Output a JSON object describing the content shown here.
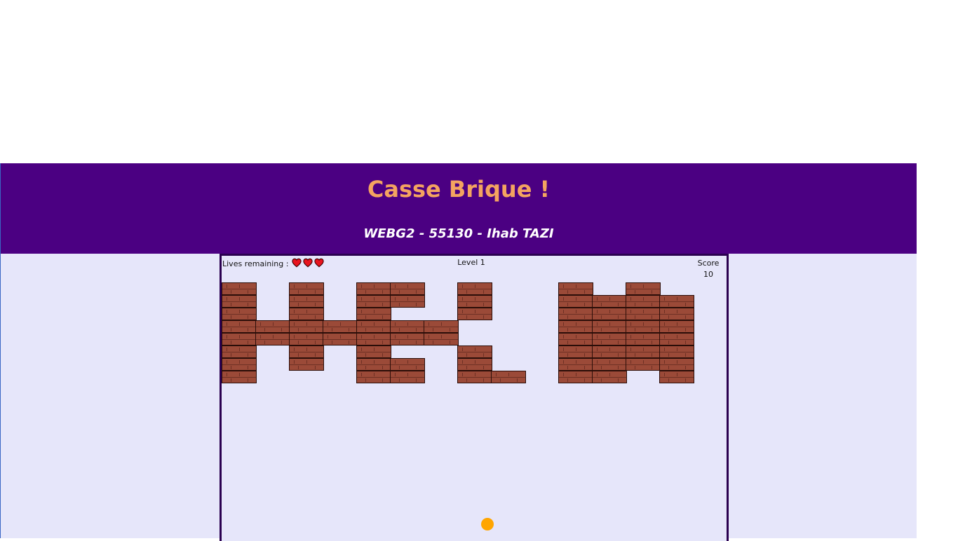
{
  "header": {
    "title": "Casse Brique !",
    "subtitle": "WEBG2 - 55130 - Ihab TAZI"
  },
  "hud": {
    "lives_label": "Lives remaining :",
    "lives_count": 3,
    "level_label": "Level 1",
    "score_label": "Score",
    "score_value": "10"
  },
  "colors": {
    "header_bg": "#4b0082",
    "title": "#f4a460",
    "playfield_bg": "#e6e6fa",
    "brick": "#9b4a38",
    "ball": "#ffa500",
    "heart": "#e8141f"
  },
  "bricks": {
    "letters_shown": "HELLO",
    "grid_columns": 15,
    "grid_rows": 8,
    "rows": [
      "1.1.11.1..1.1.",
      "1.1.11.1..1111",
      "1.1.1..1..1111",
      "1111111...1111",
      "1111111...1111",
      "1.1.1..1..1111",
      "1.1.11.1..1111",
      "1...11.11.11.1"
    ]
  }
}
